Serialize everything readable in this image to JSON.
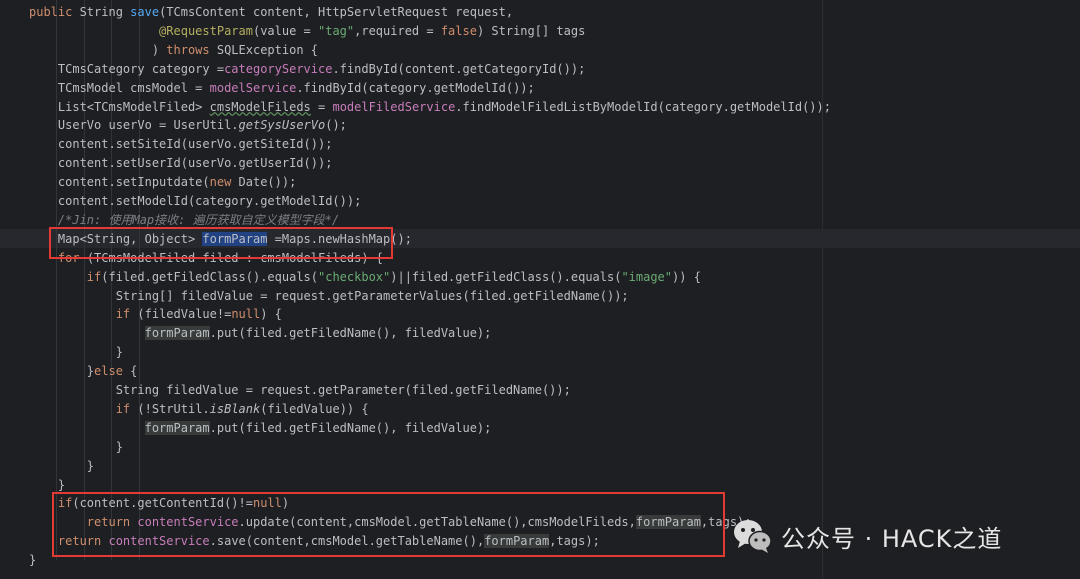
{
  "editor": {
    "lines": [
      [
        {
          "t": "public ",
          "c": "kw"
        },
        {
          "t": "String "
        },
        {
          "t": "save",
          "c": "fn"
        },
        {
          "t": "(TCmsContent content, HttpServletRequest request,"
        }
      ],
      [
        {
          "t": "                  "
        },
        {
          "t": "@RequestParam",
          "c": "ann"
        },
        {
          "t": "(value = "
        },
        {
          "t": "\"tag\"",
          "c": "str"
        },
        {
          "t": ",required = "
        },
        {
          "t": "false",
          "c": "kw"
        },
        {
          "t": ") String[] tags"
        }
      ],
      [
        {
          "t": "                 ) "
        },
        {
          "t": "throws ",
          "c": "kw"
        },
        {
          "t": "SQLException {"
        }
      ],
      [
        {
          "t": "    TCmsCategory category ="
        },
        {
          "t": "categoryService",
          "c": "fld"
        },
        {
          "t": ".findById(content.getCategoryId());"
        }
      ],
      [
        {
          "t": "    TCmsModel cmsModel = "
        },
        {
          "t": "modelService",
          "c": "fld"
        },
        {
          "t": ".findById(category.getModelId());"
        }
      ],
      [
        {
          "t": "    List<TCmsModelFiled> "
        },
        {
          "t": "cmsModelFileds",
          "c": "wavy"
        },
        {
          "t": " = "
        },
        {
          "t": "modelFiledService",
          "c": "fld"
        },
        {
          "t": ".findModelFiledListByModelId(category.getModelId());"
        }
      ],
      [
        {
          "t": "    UserVo userVo = UserUtil."
        },
        {
          "t": "getSysUserVo",
          "c": "it"
        },
        {
          "t": "();"
        }
      ],
      [
        {
          "t": "    content.setSiteId(userVo.getSiteId());"
        }
      ],
      [
        {
          "t": "    content.setUserId(userVo.getUserId());"
        }
      ],
      [
        {
          "t": "    content.setInputdate("
        },
        {
          "t": "new ",
          "c": "kw"
        },
        {
          "t": "Date());"
        }
      ],
      [
        {
          "t": "    content.setModelId(category.getModelId());"
        }
      ],
      [
        {
          "t": "    /*Jin: 使用Map接收: 遍历获取自定义模型字段*/",
          "c": "cmt"
        }
      ],
      [
        {
          "t": "    Map<String, Object> "
        },
        {
          "t": "formParam",
          "c": "sel"
        },
        {
          "t": " =Maps.newHashMap();"
        }
      ],
      [
        {
          "t": "    "
        },
        {
          "t": "for ",
          "c": "kw"
        },
        {
          "t": "(TCmsModelFiled filed : cmsModelFileds) {"
        }
      ],
      [
        {
          "t": "        "
        },
        {
          "t": "if",
          "c": "kw"
        },
        {
          "t": "(filed.getFiledClass().equals("
        },
        {
          "t": "\"checkbox\"",
          "c": "str"
        },
        {
          "t": ")||filed.getFiledClass().equals("
        },
        {
          "t": "\"image\"",
          "c": "str"
        },
        {
          "t": ")) {"
        }
      ],
      [
        {
          "t": "            String[] filedValue = request.getParameterValues(filed.getFiledName());"
        }
      ],
      [
        {
          "t": "            "
        },
        {
          "t": "if ",
          "c": "kw"
        },
        {
          "t": "(filedValue!="
        },
        {
          "t": "null",
          "c": "kw"
        },
        {
          "t": ") {"
        }
      ],
      [
        {
          "t": "                "
        },
        {
          "t": "formParam",
          "c": "use"
        },
        {
          "t": ".put(filed.getFiledName(), filedValue);"
        }
      ],
      [
        {
          "t": "            }"
        }
      ],
      [
        {
          "t": "        }"
        },
        {
          "t": "else ",
          "c": "kw"
        },
        {
          "t": "{"
        }
      ],
      [
        {
          "t": "            String filedValue = request.getParameter(filed.getFiledName());"
        }
      ],
      [
        {
          "t": "            "
        },
        {
          "t": "if ",
          "c": "kw"
        },
        {
          "t": "(!StrUtil."
        },
        {
          "t": "isBlank",
          "c": "it"
        },
        {
          "t": "(filedValue)) {"
        }
      ],
      [
        {
          "t": "                "
        },
        {
          "t": "formParam",
          "c": "use"
        },
        {
          "t": ".put(filed.getFiledName(), filedValue);"
        }
      ],
      [
        {
          "t": "            }"
        }
      ],
      [
        {
          "t": "        }"
        }
      ],
      [
        {
          "t": "    }"
        }
      ],
      [
        {
          "t": "    "
        },
        {
          "t": "if",
          "c": "kw"
        },
        {
          "t": "(content.getContentId()!="
        },
        {
          "t": "null",
          "c": "kw"
        },
        {
          "t": ")"
        }
      ],
      [
        {
          "t": "        "
        },
        {
          "t": "return ",
          "c": "kw"
        },
        {
          "t": "contentService",
          "c": "fld"
        },
        {
          "t": ".update(content,cmsModel.getTableName(),cmsModelFileds,"
        },
        {
          "t": "formParam",
          "c": "use"
        },
        {
          "t": ",tags);"
        }
      ],
      [
        {
          "t": "    "
        },
        {
          "t": "return ",
          "c": "kw"
        },
        {
          "t": "contentService",
          "c": "fld"
        },
        {
          "t": ".save(content,cmsModel.getTableName(),"
        },
        {
          "t": "formParam",
          "c": "use"
        },
        {
          "t": ",tags);"
        }
      ],
      [
        {
          "t": "}"
        }
      ]
    ]
  },
  "watermark": {
    "text": "公众号 · HACK之道",
    "icon": "wechat-icon"
  },
  "colors": {
    "background": "#1e1f22",
    "keyword": "#cf8e6d",
    "field": "#c77dbb",
    "string": "#6aab73",
    "annotation": "#b3ae60",
    "comment": "#7a7e85",
    "highlight_box": "#e53935",
    "selection": "#214283"
  }
}
